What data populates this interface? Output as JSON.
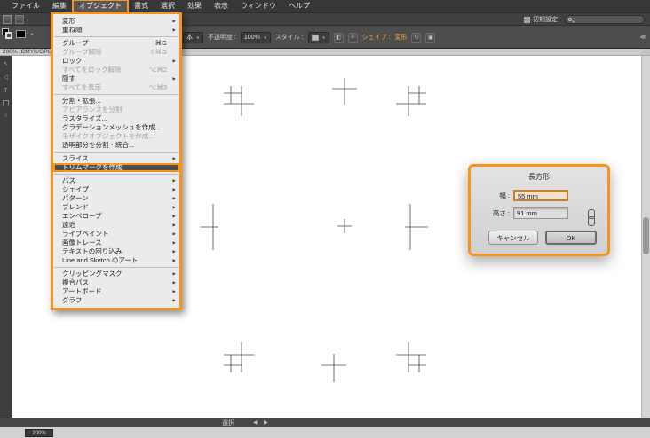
{
  "menu_bar": {
    "items": [
      {
        "label": "ファイル"
      },
      {
        "label": "編集"
      },
      {
        "label": "オブジェクト",
        "active": true
      },
      {
        "label": "書式"
      },
      {
        "label": "選択"
      },
      {
        "label": "効果"
      },
      {
        "label": "表示"
      },
      {
        "label": "ウィンドウ"
      },
      {
        "label": "ヘルプ"
      }
    ]
  },
  "workspace_bar": {
    "workspace_label": "初期設定"
  },
  "control_panel": {
    "style_partial": "本",
    "opacity_label": "不透明度 :",
    "opacity_value": "100%",
    "style_label": "スタイル :",
    "shape_label": "シェイプ :",
    "transform_label": "変形",
    "collapse_label": "≪"
  },
  "object_menu": {
    "items": [
      {
        "label": "変形",
        "submenu": true
      },
      {
        "label": "重ね順",
        "submenu": true
      },
      {
        "separator": true
      },
      {
        "label": "グループ",
        "shortcut": "⌘G"
      },
      {
        "label": "グループ解除",
        "shortcut": "⇧⌘G",
        "disabled": true
      },
      {
        "label": "ロック",
        "submenu": true
      },
      {
        "label": "すべてをロック解除",
        "shortcut": "⌥⌘2",
        "disabled": true
      },
      {
        "label": "隠す",
        "submenu": true
      },
      {
        "label": "すべてを表示",
        "shortcut": "⌥⌘3",
        "disabled": true
      },
      {
        "separator": true
      },
      {
        "label": "分割・拡張..."
      },
      {
        "label": "アピアランスを分割",
        "disabled": true
      },
      {
        "label": "ラスタライズ..."
      },
      {
        "label": "グラデーションメッシュを作成..."
      },
      {
        "label": "モザイクオブジェクトを作成...",
        "disabled": true
      },
      {
        "label": "透明部分を分割・統合..."
      },
      {
        "separator": true
      },
      {
        "label": "スライス",
        "submenu": true
      },
      {
        "label": "トリムマークを作成",
        "highlighted": true
      },
      {
        "separator": true
      },
      {
        "label": "パス",
        "submenu": true
      },
      {
        "label": "シェイプ",
        "submenu": true
      },
      {
        "label": "パターン",
        "submenu": true
      },
      {
        "label": "ブレンド",
        "submenu": true
      },
      {
        "label": "エンベロープ",
        "submenu": true
      },
      {
        "label": "遠近",
        "submenu": true
      },
      {
        "label": "ライブペイント",
        "submenu": true
      },
      {
        "label": "画像トレース",
        "submenu": true
      },
      {
        "label": "テキストの回り込み",
        "submenu": true
      },
      {
        "label": "Line and Sketch のアート",
        "submenu": true
      },
      {
        "separator": true
      },
      {
        "label": "クリッピングマスク",
        "submenu": true
      },
      {
        "label": "複合パス",
        "submenu": true
      },
      {
        "label": "アートボード",
        "submenu": true
      },
      {
        "label": "グラフ",
        "submenu": true
      }
    ]
  },
  "document": {
    "tab_title": "200% (CMYK/GPU"
  },
  "dialog": {
    "title": "長方形",
    "width_label": "幅 :",
    "width_value": "55 mm",
    "height_label": "高さ :",
    "height_value": "91 mm",
    "cancel_label": "キャンセル",
    "ok_label": "OK"
  },
  "status_bar": {
    "tool_label": "選択",
    "zoom_value": "200%"
  },
  "colors": {
    "annotation_orange": "#F7941D",
    "link_orange": "#F7A13D"
  }
}
